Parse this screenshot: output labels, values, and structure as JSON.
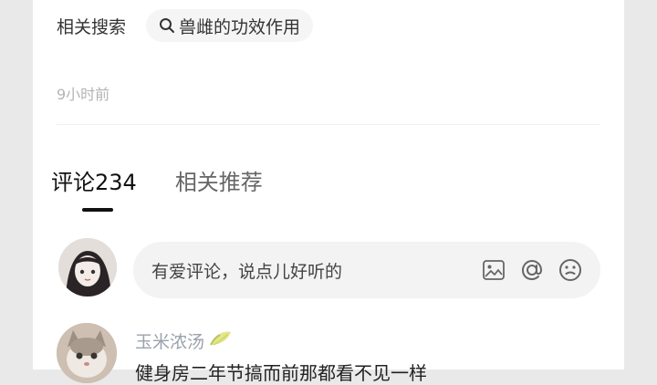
{
  "related": {
    "label": "相关搜索",
    "chip_text": "兽雌的功效作用",
    "chip_icon": "search-icon"
  },
  "post": {
    "timestamp": "9小时前"
  },
  "tabs": [
    {
      "label": "评论234",
      "active": true
    },
    {
      "label": "相关推荐",
      "active": false
    }
  ],
  "comment_input": {
    "placeholder": "有爱评论，说点儿好听的",
    "icons": [
      "image-icon",
      "at-icon",
      "emoji-icon"
    ]
  },
  "comments": [
    {
      "username": "玉米浓汤",
      "badge_icon": "corn-emoji-icon",
      "text": "健身房二年节搞而前那都看不见一样"
    }
  ],
  "colors": {
    "username": "#9aa2ad",
    "timestamp": "#b4b4b4",
    "panel_bg": "#ffffff",
    "outer_bg": "#e9e9e9"
  }
}
